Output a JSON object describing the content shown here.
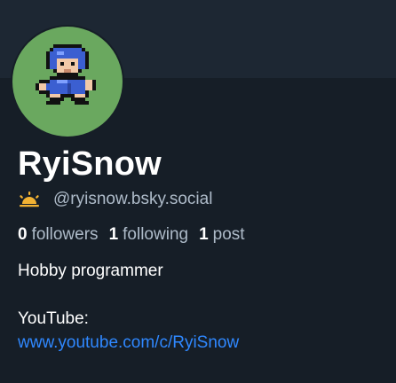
{
  "profile": {
    "display_name": "RyiSnow",
    "handle": "@ryisnow.bsky.social",
    "badge_icon": "sun-icon",
    "avatar_bg": "#6aa85f",
    "stats": {
      "followers_count": "0",
      "followers_label": "followers",
      "following_count": "1",
      "following_label": "following",
      "posts_count": "1",
      "posts_label": "post"
    },
    "bio": {
      "line1": "Hobby programmer",
      "line2": "YouTube:",
      "link": "www.youtube.com/c/RyiSnow"
    }
  },
  "colors": {
    "background": "#161e27",
    "text": "#ffffff",
    "muted": "#aebbc9",
    "link": "#2f88ff"
  }
}
